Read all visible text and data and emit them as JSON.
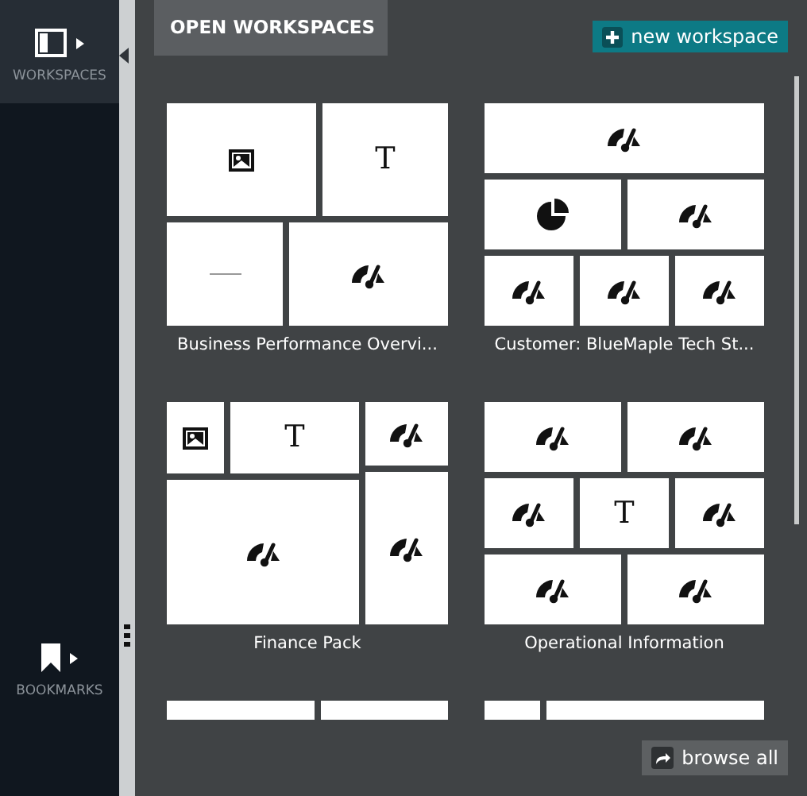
{
  "sidebar": {
    "items": [
      {
        "label": "WORKSPACES",
        "kind": "panel",
        "selected": true
      },
      {
        "label": "BOOKMARKS",
        "kind": "bookmark",
        "selected": false
      }
    ]
  },
  "panel": {
    "title": "OPEN WORKSPACES",
    "new_button": "new workspace",
    "browse_button": "browse all"
  },
  "workspaces": [
    {
      "title": "Business Performance Overvi...",
      "tiles": [
        {
          "kind": "image"
        },
        {
          "kind": "text",
          "glyph": "T"
        },
        {
          "kind": "line"
        },
        {
          "kind": "gauge"
        }
      ]
    },
    {
      "title": "Customer: BlueMaple Tech St...",
      "tiles": [
        {
          "kind": "gauge"
        },
        {
          "kind": "pie"
        },
        {
          "kind": "gauge"
        },
        {
          "kind": "gauge"
        },
        {
          "kind": "gauge"
        },
        {
          "kind": "gauge"
        }
      ]
    },
    {
      "title": "Finance Pack",
      "tiles": [
        {
          "kind": "image"
        },
        {
          "kind": "text",
          "glyph": "T"
        },
        {
          "kind": "gauge"
        },
        {
          "kind": "gauge"
        },
        {
          "kind": "gauge"
        }
      ]
    },
    {
      "title": "Operational Information",
      "tiles": [
        {
          "kind": "gauge"
        },
        {
          "kind": "gauge"
        },
        {
          "kind": "gauge"
        },
        {
          "kind": "text",
          "glyph": "T"
        },
        {
          "kind": "gauge"
        },
        {
          "kind": "gauge"
        },
        {
          "kind": "gauge"
        }
      ]
    },
    {
      "tiles": [
        {
          "kind": "blank"
        },
        {
          "kind": "blank"
        }
      ]
    },
    {
      "tiles": [
        {
          "kind": "blank"
        },
        {
          "kind": "blank"
        }
      ]
    }
  ]
}
